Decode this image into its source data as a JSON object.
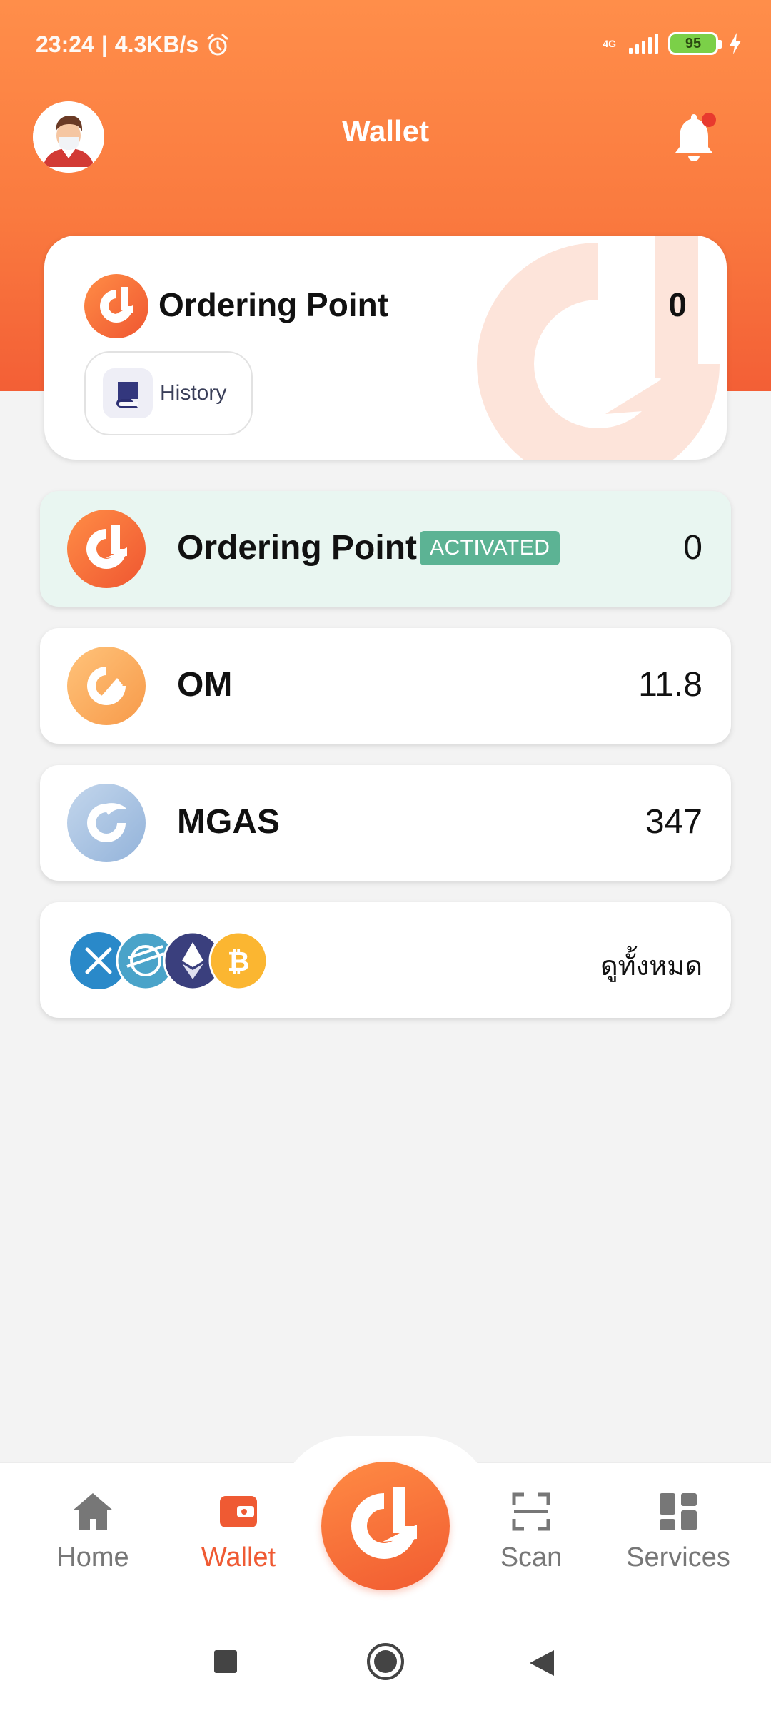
{
  "status": {
    "time": "23:24",
    "speed": "4.3KB/s",
    "network": "4G",
    "battery": "95"
  },
  "header": {
    "title": "Wallet"
  },
  "point_card": {
    "title": "Ordering Point",
    "value": "0",
    "history_label": "History"
  },
  "assets": [
    {
      "name": "Ordering Point",
      "badge": "ACTIVATED",
      "amount": "0",
      "icon": "ordering-point-icon"
    },
    {
      "name": "OM",
      "amount": "11.8",
      "icon": "om-coin-icon"
    },
    {
      "name": "MGAS",
      "amount": "347",
      "icon": "mgas-coin-icon"
    }
  ],
  "more_coins": {
    "label": "ดูทั้งหมด",
    "icons": [
      "xrp-icon",
      "stellar-icon",
      "ethereum-icon",
      "bitcoin-icon"
    ]
  },
  "nav": {
    "home": "Home",
    "wallet": "Wallet",
    "scan": "Scan",
    "services": "Services"
  },
  "colors": {
    "accent": "#f26a38",
    "activated_badge": "#5cb394",
    "activated_row": "#e9f6f1"
  }
}
